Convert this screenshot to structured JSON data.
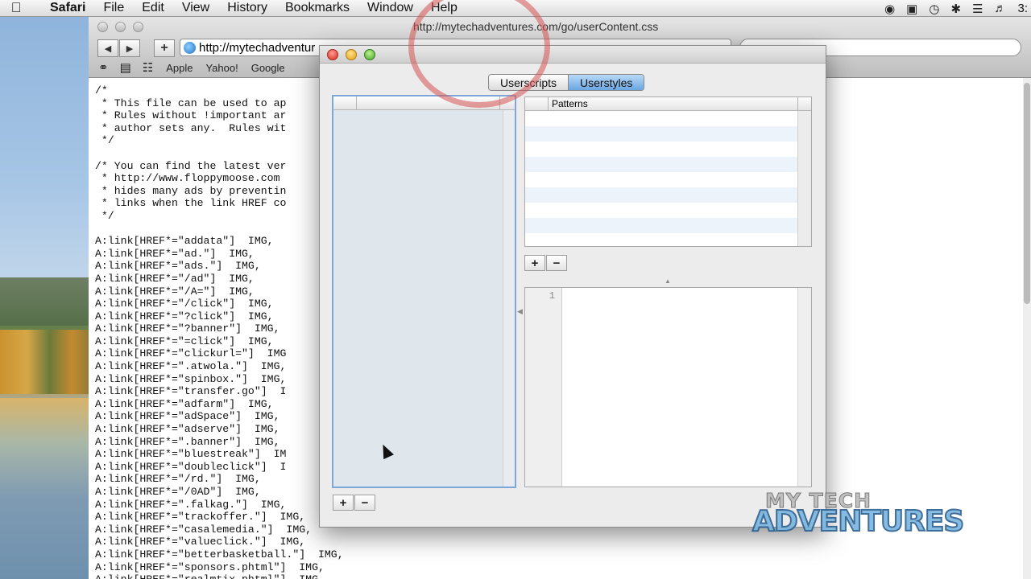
{
  "menubar": {
    "apple_icon": "apple-logo",
    "app_name": "Safari",
    "items": [
      "File",
      "Edit",
      "View",
      "History",
      "Bookmarks",
      "Window",
      "Help"
    ],
    "clock": "3:"
  },
  "safari": {
    "title": "http://mytechadventures.com/go/userContent.css",
    "address": "http://mytechadventur",
    "bookmarks": [
      "Apple",
      "Yahoo!",
      "Google"
    ],
    "code_lines": [
      "/*",
      " * This file can be used to ap",
      " * Rules without !important ar",
      " * author sets any.  Rules wit",
      " */",
      "",
      "/* You can find the latest ver",
      " * http://www.floppymoose.com",
      " * hides many ads by preventin",
      " * links when the link HREF co",
      " */",
      "",
      "A:link[HREF*=\"addata\"]  IMG,",
      "A:link[HREF*=\"ad.\"]  IMG,",
      "A:link[HREF*=\"ads.\"]  IMG,",
      "A:link[HREF*=\"/ad\"]  IMG,",
      "A:link[HREF*=\"/A=\"]  IMG,",
      "A:link[HREF*=\"/click\"]  IMG,",
      "A:link[HREF*=\"?click\"]  IMG,",
      "A:link[HREF*=\"?banner\"]  IMG,",
      "A:link[HREF*=\"=click\"]  IMG,",
      "A:link[HREF*=\"clickurl=\"]  IMG",
      "A:link[HREF*=\".atwola.\"]  IMG,",
      "A:link[HREF*=\"spinbox.\"]  IMG,",
      "A:link[HREF*=\"transfer.go\"]  I",
      "A:link[HREF*=\"adfarm\"]  IMG,",
      "A:link[HREF*=\"adSpace\"]  IMG,",
      "A:link[HREF*=\"adserve\"]  IMG,",
      "A:link[HREF*=\".banner\"]  IMG,",
      "A:link[HREF*=\"bluestreak\"]  IM",
      "A:link[HREF*=\"doubleclick\"]  I",
      "A:link[HREF*=\"/rd.\"]  IMG,",
      "A:link[HREF*=\"/0AD\"]  IMG,",
      "A:link[HREF*=\".falkag.\"]  IMG,",
      "A:link[HREF*=\"trackoffer.\"]  IMG,",
      "A:link[HREF*=\"casalemedia.\"]  IMG,",
      "A:link[HREF*=\"valueclick.\"]  IMG,",
      "A:link[HREF*=\"betterbasketball.\"]  IMG,",
      "A:link[HREF*=\"sponsors.phtml\"]  IMG,",
      "A:link[HREF*=\"realmtix.phtml\"]  IMG,"
    ]
  },
  "dialog": {
    "tabs": [
      "Userscripts",
      "Userstyles"
    ],
    "active_tab": "Userstyles",
    "patterns_header": "Patterns",
    "add_label": "+",
    "remove_label": "−",
    "line_number": "1"
  },
  "watermark": {
    "line1": "MY TECH",
    "line2": "ADVENTURES"
  },
  "colors": {
    "accent": "#6aa6e2",
    "annotation_circle": "#d65353"
  }
}
